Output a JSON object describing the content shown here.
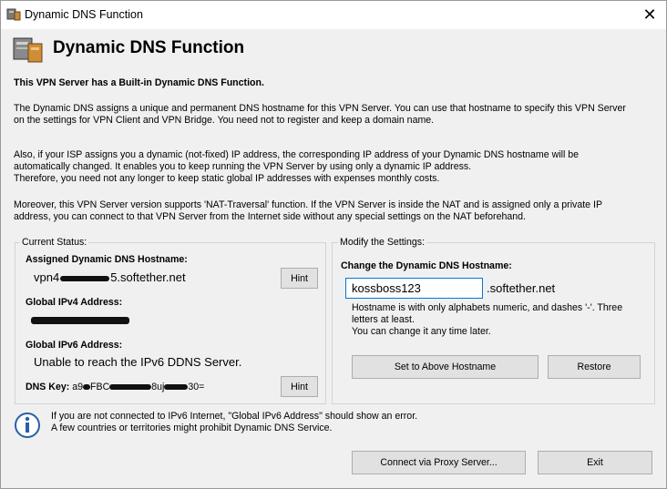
{
  "window": {
    "title": "Dynamic DNS Function"
  },
  "header": {
    "title": "Dynamic DNS Function"
  },
  "intro": {
    "line1": "This VPN Server has a Built-in Dynamic DNS Function.",
    "para1_l1": "The Dynamic DNS assigns a unique and permanent DNS hostname for this VPN Server. You can use that hostname to specify this VPN Server",
    "para1_l2": "on the settings for VPN Client and VPN Bridge. You need not to register and keep a domain name.",
    "para2_l1": "Also, if your ISP assigns you a dynamic (not-fixed) IP address, the corresponding IP address of your Dynamic DNS hostname will be",
    "para2_l2": "automatically changed. It enables you to keep running the VPN Server by using only a dynamic IP address.",
    "para2_l3": "Therefore, you need not any longer to keep static global IP addresses with expenses monthly costs.",
    "para3_l1": "Moreover, this VPN Server version supports 'NAT-Traversal' function. If the VPN Server is inside the NAT and is assigned only a private IP",
    "para3_l2": "address, you can connect to that VPN Server from the Internet side without any special settings on the NAT beforehand."
  },
  "status": {
    "legend": "Current Status:",
    "hostname_label": "Assigned Dynamic DNS Hostname:",
    "hostname_prefix": "vpn4",
    "hostname_suffix": "5.softether.net",
    "hint_label": "Hint",
    "ipv4_label": "Global IPv4 Address:",
    "ipv6_label": "Global IPv6 Address:",
    "ipv6_value": "Unable to reach the IPv6 DDNS Server.",
    "dnskey_label": "DNS Key:",
    "dnskey_prefix": "a9",
    "dnskey_mid": "FBC",
    "dnskey_mid2": "8uj",
    "dnskey_suffix": "30=",
    "hint2_label": "Hint"
  },
  "modify": {
    "legend": "Modify the Settings:",
    "change_label": "Change the Dynamic DNS Hostname:",
    "hostname_value": "kossboss123",
    "domain_suffix": ".softether.net",
    "note_l1": "Hostname is with only alphabets numeric, and dashes '-'. Three",
    "note_l2": "letters at least.",
    "note_l3": "You can change it any time later.",
    "set_button": "Set to Above Hostname",
    "restore_button": "Restore"
  },
  "notice": {
    "line1": "If you are not connected to IPv6 Internet, \"Global IPv6 Address\" should show an error.",
    "line2": "A few countries or territories might prohibit Dynamic DNS Service."
  },
  "footer": {
    "proxy_button": "Connect via Proxy Server...",
    "exit_button": "Exit"
  }
}
